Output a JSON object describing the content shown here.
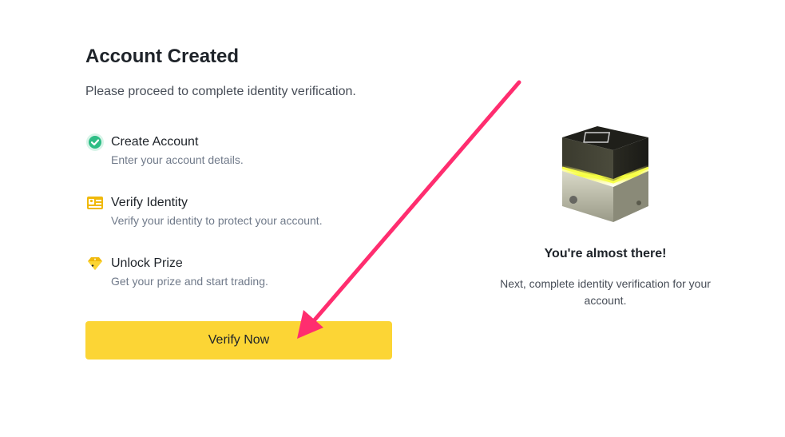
{
  "header": {
    "title": "Account Created",
    "subtitle": "Please proceed to complete identity verification."
  },
  "steps": [
    {
      "icon": "check-circle-icon",
      "title": "Create Account",
      "description": "Enter your account details."
    },
    {
      "icon": "id-card-icon",
      "title": "Verify Identity",
      "description": "Verify your identity to protect your account."
    },
    {
      "icon": "diamond-prize-icon",
      "title": "Unlock Prize",
      "description": "Get your prize and start trading."
    }
  ],
  "cta": {
    "label": "Verify Now"
  },
  "side_panel": {
    "image": "mystery-box-icon",
    "title": "You're almost there!",
    "description": "Next, complete identity verification for your account."
  },
  "colors": {
    "accent": "#fcd535",
    "success": "#2ebd85",
    "annotation_arrow": "#ff2d6f",
    "text_primary": "#1e2329",
    "text_secondary": "#707a8a"
  }
}
